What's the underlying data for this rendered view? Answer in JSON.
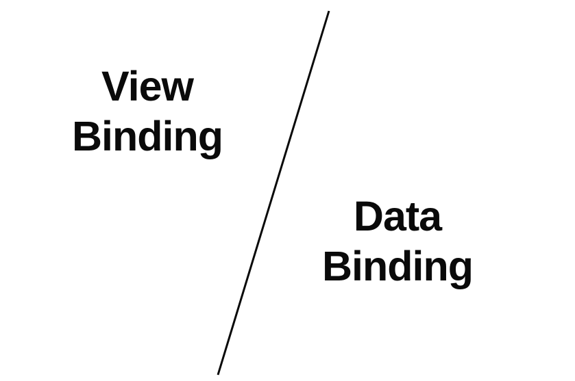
{
  "left": {
    "line1": "View",
    "line2": "Binding"
  },
  "right": {
    "line1": "Data",
    "line2": "Binding"
  }
}
